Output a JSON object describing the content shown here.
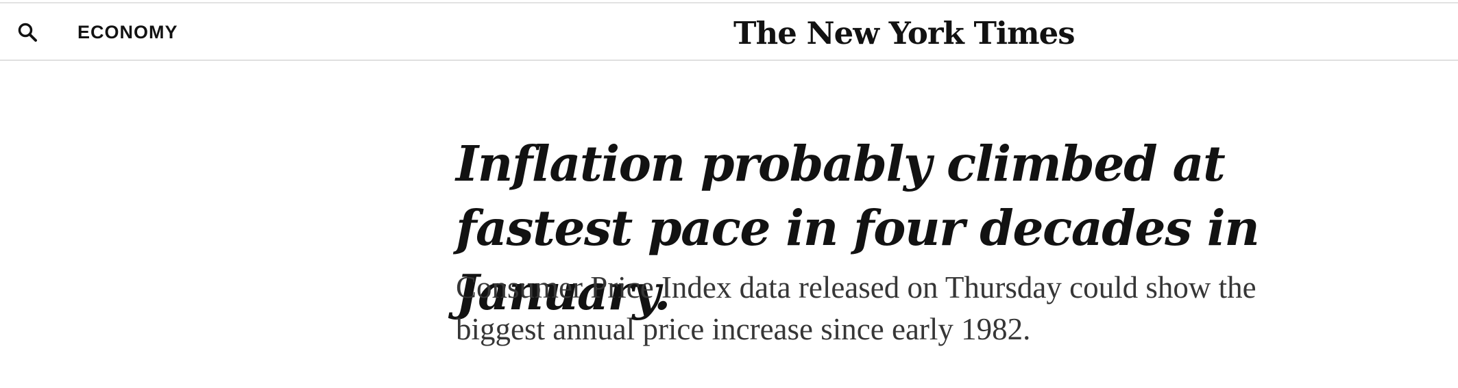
{
  "header": {
    "search_icon": "search-icon",
    "section_label": "ECONOMY",
    "logo_text": "The New York Times"
  },
  "article": {
    "headline": "Inflation probably climbed at fastest pace in four decades in January.",
    "summary": "Consumer Price Index data released on Thursday could show the biggest annual price increase since early 1982."
  }
}
